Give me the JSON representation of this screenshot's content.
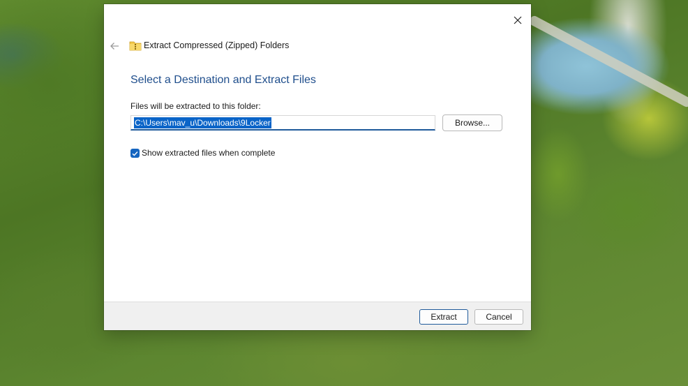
{
  "dialog": {
    "title": "Extract Compressed (Zipped) Folders",
    "heading": "Select a Destination and Extract Files",
    "destination_label": "Files will be extracted to this folder:",
    "destination_path": "C:\\Users\\mav_u\\Downloads\\9Locker",
    "browse_label": "Browse...",
    "show_files_label": "Show extracted files when complete",
    "show_files_checked": true,
    "extract_label": "Extract",
    "cancel_label": "Cancel"
  },
  "icons": {
    "close": "close-icon",
    "back": "back-arrow-icon",
    "folder": "zip-folder-icon",
    "check": "checkmark-icon"
  },
  "colors": {
    "accent": "#1565c0",
    "heading": "#1f4e8c",
    "selection": "#0a64c8",
    "footer_bg": "#f0f0f0"
  }
}
